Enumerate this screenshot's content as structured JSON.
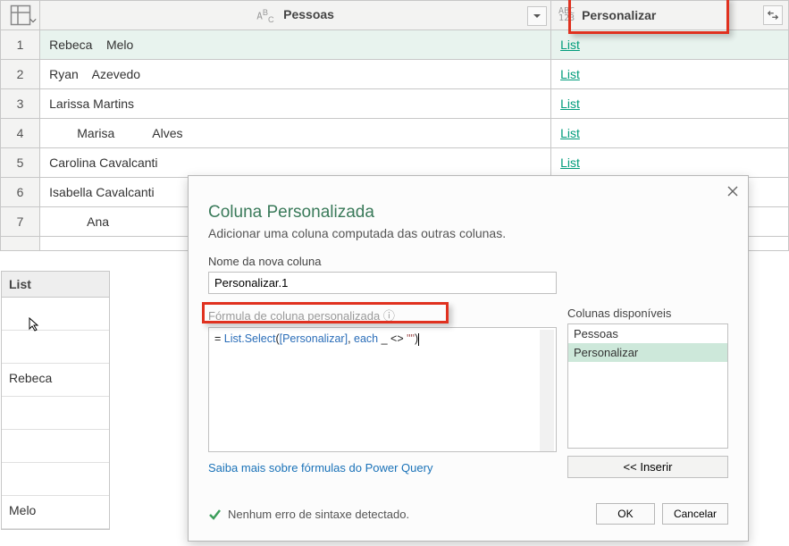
{
  "columns": {
    "col1": {
      "label": "Pessoas"
    },
    "col2": {
      "label": "Personalizar"
    }
  },
  "rows": [
    {
      "n": "1",
      "name": "Rebeca    Melo",
      "val": "List",
      "selected": true
    },
    {
      "n": "2",
      "name": "Ryan    Azevedo",
      "val": "List",
      "selected": false
    },
    {
      "n": "3",
      "name": "Larissa Martins",
      "val": "List",
      "selected": false
    },
    {
      "n": "4",
      "name": "        Marisa           Alves",
      "val": "List",
      "selected": false
    },
    {
      "n": "5",
      "name": "Carolina Cavalcanti",
      "val": "List",
      "selected": false
    },
    {
      "n": "6",
      "name": "Isabella Cavalcanti",
      "val": "",
      "selected": false
    },
    {
      "n": "7",
      "name": "           Ana",
      "val": "",
      "selected": false
    },
    {
      "n": "",
      "name": "",
      "val": "",
      "selected": false
    }
  ],
  "list_panel": {
    "header": "List",
    "items": [
      "",
      "",
      "Rebeca",
      "",
      "",
      "",
      "Melo"
    ]
  },
  "dialog": {
    "title": "Coluna Personalizada",
    "subtitle": "Adicionar uma coluna computada das outras colunas.",
    "name_label": "Nome da nova coluna",
    "name_value": "Personalizar.1",
    "formula_label": "Fórmula de coluna personalizada",
    "formula_prefix": "= ",
    "formula_tokens": {
      "a": "List.Select",
      "b": "(",
      "c": "[Personalizar]",
      "d": ", ",
      "e": "each",
      "f": " _ <> ",
      "g": "\"\"",
      "h": ")"
    },
    "avail_label": "Colunas disponíveis",
    "avail_cols": [
      "Pessoas",
      "Personalizar"
    ],
    "insert_label": "<< Inserir",
    "learn_more": "Saiba mais sobre fórmulas do Power Query",
    "status_msg": "Nenhum erro de sintaxe detectado.",
    "ok": "OK",
    "cancel": "Cancelar"
  }
}
